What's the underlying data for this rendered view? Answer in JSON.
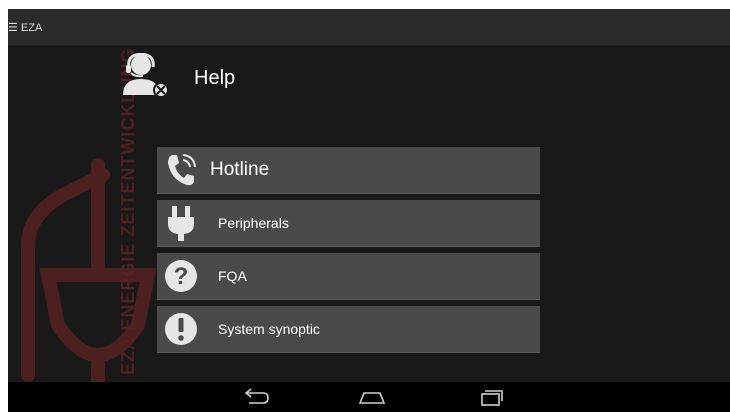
{
  "topbar": {
    "app_title": "☰ EZA"
  },
  "watermark": {
    "text": "EZA ENERGIE ZEITENTWICKLUNG",
    "icon": "plug-logo-icon"
  },
  "page": {
    "title": "Help",
    "icon": "support-agent-icon"
  },
  "menu": [
    {
      "label": "Hotline",
      "icon": "phone-icon"
    },
    {
      "label": "Peripherals",
      "icon": "plug-icon"
    },
    {
      "label": "FQA",
      "icon": "question-icon"
    },
    {
      "label": "System synoptic",
      "icon": "exclamation-icon"
    }
  ],
  "navbar": {
    "buttons": [
      "back-icon",
      "home-icon",
      "recents-icon"
    ]
  },
  "colors": {
    "button_bg": "#4a4a4a",
    "screen_bg": "#1c1c1c",
    "watermark": "#5a2222",
    "icon": "#e6e6e6"
  }
}
